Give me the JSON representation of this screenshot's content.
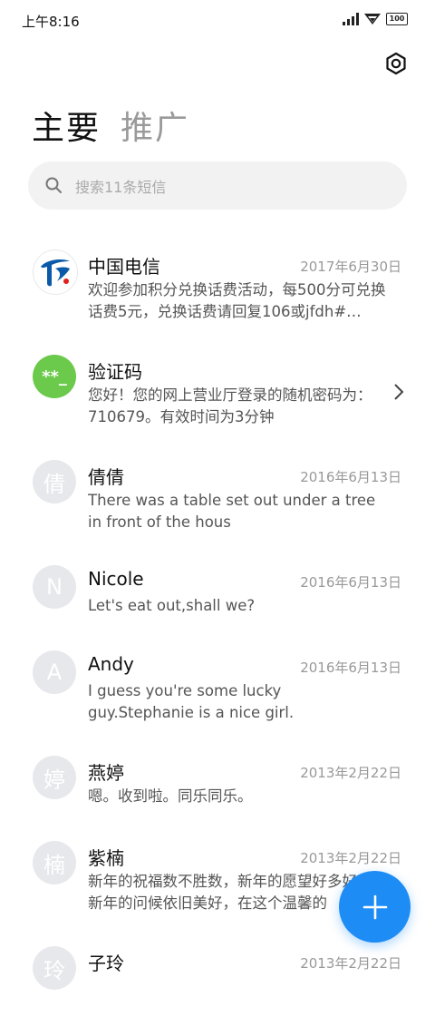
{
  "status_bar": {
    "time": "上午8:16",
    "battery": "100"
  },
  "tabs": [
    {
      "label": "主要"
    },
    {
      "label": "推广"
    }
  ],
  "search": {
    "placeholder": "搜索11条短信"
  },
  "conversations": [
    {
      "name": "中国电信",
      "date": "2017年6月30日",
      "preview": "欢迎参加积分兑换话费活动，每500分可兑换话费5元，兑换话费请回复106或jfdh#…",
      "avatar_type": "telecom-logo"
    },
    {
      "name": "验证码",
      "date": "",
      "preview": "您好！您的网上营业厅登录的随机密码为：710679。有效时间为3分钟",
      "avatar_text": "**_",
      "avatar_type": "verification-code"
    },
    {
      "name": "倩倩",
      "date": "2016年6月13日",
      "preview": "There was a table set out under a tree in front of the hous",
      "avatar_text": "倩"
    },
    {
      "name": "Nicole",
      "date": "2016年6月13日",
      "preview": "Let's eat out,shall we?",
      "avatar_text": "N"
    },
    {
      "name": "Andy",
      "date": "2016年6月13日",
      "preview": "I guess you're some lucky guy.Stephanie is a nice girl.",
      "avatar_text": "A"
    },
    {
      "name": "燕婷",
      "date": "2013年2月22日",
      "preview": "嗯。收到啦。同乐同乐。",
      "avatar_text": "婷"
    },
    {
      "name": "紫楠",
      "date": "2013年2月22日",
      "preview": "新年的祝福数不胜数，新年的愿望好多好多，新年的问候依旧美好，在这个温馨的",
      "avatar_text": "楠"
    },
    {
      "name": "子玲",
      "date": "2013年2月22日",
      "preview": "",
      "avatar_text": "玲"
    }
  ],
  "icons": {
    "settings": "gear-icon",
    "search": "search-icon",
    "chevron": "chevron-right-icon",
    "fab": "plus-icon"
  },
  "colors": {
    "accent": "#1e8cf5",
    "telecom_blue": "#0b5aa9",
    "verification_green": "#6bc94b",
    "avatar_gray": "#e6e8ec"
  }
}
